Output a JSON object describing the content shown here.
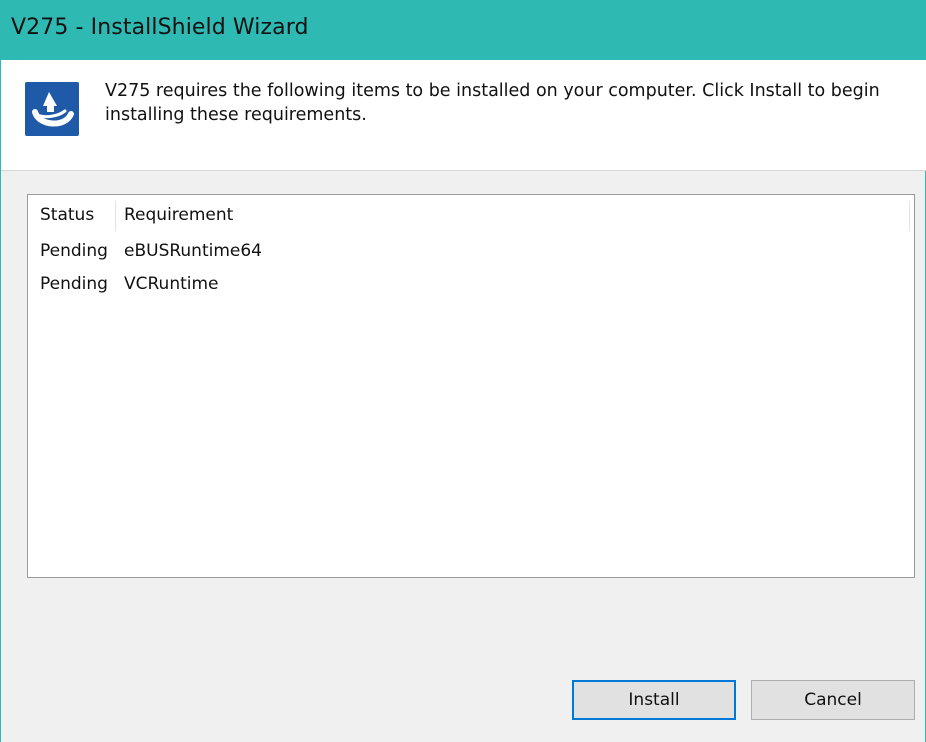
{
  "window": {
    "title": "V275 - InstallShield Wizard"
  },
  "header": {
    "icon": "installshield-app-icon",
    "message": "V275 requires the following items to be installed on your computer. Click Install to begin installing these requirements."
  },
  "requirements": {
    "columns": {
      "status": "Status",
      "requirement": "Requirement"
    },
    "rows": [
      {
        "status": "Pending",
        "requirement": "eBUSRuntime64"
      },
      {
        "status": "Pending",
        "requirement": "VCRuntime"
      }
    ]
  },
  "buttons": {
    "install": "Install",
    "cancel": "Cancel"
  },
  "colors": {
    "titlebar": "#2ebab3",
    "icon_background": "#1f5aa8",
    "default_button_border": "#0078d7"
  }
}
